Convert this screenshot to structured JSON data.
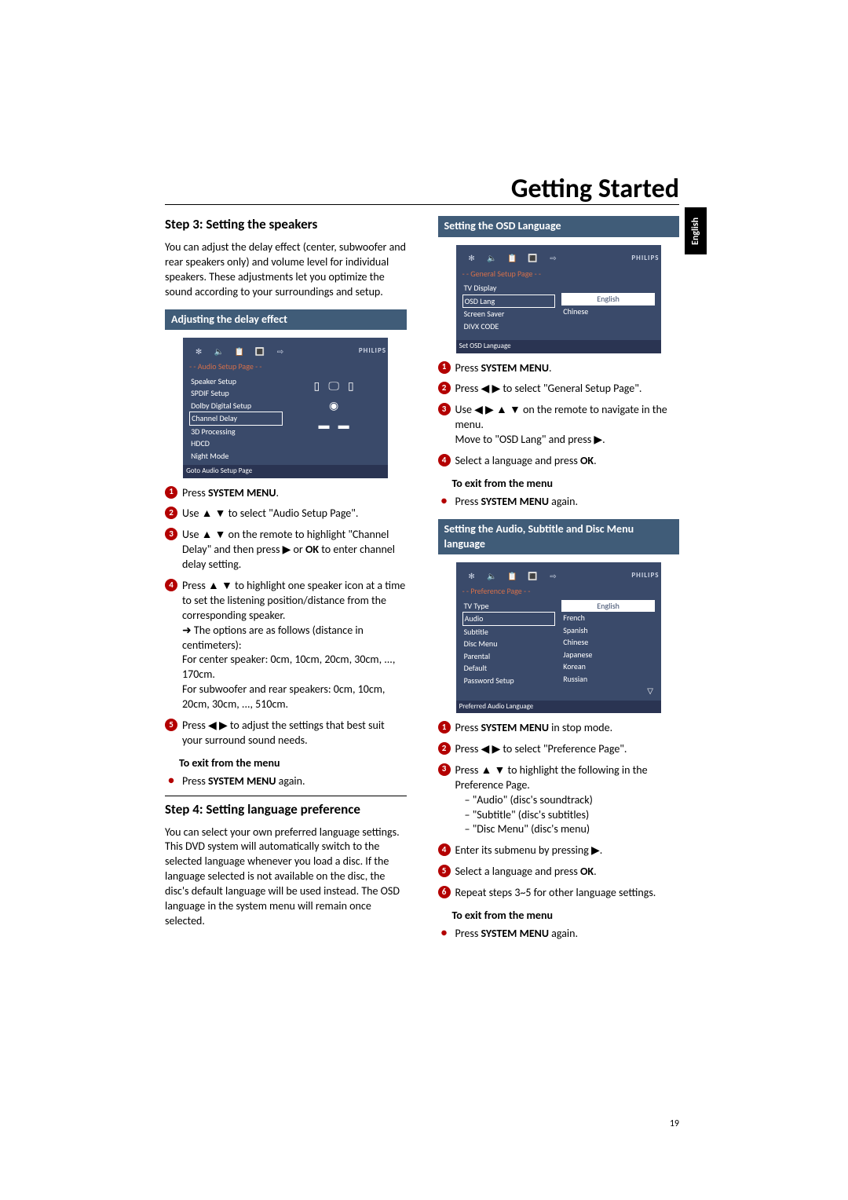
{
  "page_title": "Getting Started",
  "side_tab": "English",
  "page_number": "19",
  "left": {
    "step3_head": "Step 3:  Setting the speakers",
    "step3_intro": "You can adjust the delay effect (center, subwoofer and rear speakers only) and volume level for individual speakers. These adjustments let you optimize the sound according to your surroundings and setup.",
    "adjust_bar": "Adjusting the delay effect",
    "osd_audio": {
      "subtitle": "- -  Audio  Setup  Page  - -",
      "items": [
        "Speaker Setup",
        "SPDIF Setup",
        "Dolby Digital Setup",
        "Channel Delay",
        "3D Processing",
        "HDCD",
        "Night Mode"
      ],
      "footer": "Goto Audio Setup Page"
    },
    "i1": {
      "pre": "Press ",
      "b": "SYSTEM MENU",
      "post": "."
    },
    "i2": "Use ▲ ▼ to select \"Audio Setup Page\".",
    "i3": {
      "part1": "Use ▲ ▼ on the remote to highlight \"Channel Delay\" and then press ▶ or ",
      "b": "OK",
      "part2": " to enter channel delay setting."
    },
    "i4": {
      "l1": "Press ▲ ▼ to highlight one speaker icon at a time to set the listening position/distance from the corresponding speaker.",
      "l2": "➜ The options are as follows (distance in centimeters):",
      "l3": "For center speaker: 0cm, 10cm, 20cm, 30cm, ..., 170cm.",
      "l4": "For subwoofer and rear speakers: 0cm, 10cm, 20cm, 30cm, ..., 510cm."
    },
    "i5": "Press ◀ ▶ to adjust the settings that best suit your surround sound needs.",
    "exit_head": "To exit from the menu",
    "exit": {
      "pre": "Press ",
      "b": "SYSTEM MENU",
      "post": " again."
    },
    "step4_head": "Step 4:  Setting language preference",
    "step4_intro": "You can select your own preferred language settings. This DVD system will automatically switch to the selected language whenever you load a disc. If the language selected is not available on the disc, the disc's default language will be used instead. The OSD language in the system menu will remain once selected."
  },
  "right": {
    "osd_bar": "Setting the OSD Language",
    "osd_general": {
      "subtitle": "- -  General  Setup  Page  - -",
      "left_items": [
        "TV Display",
        "OSD Lang",
        "Screen Saver",
        "DIVX CODE"
      ],
      "right_items": [
        "English",
        "Chinese"
      ],
      "footer": "Set OSD Language"
    },
    "r1": {
      "pre": "Press ",
      "b": "SYSTEM MENU",
      "post": "."
    },
    "r2": "Press ◀ ▶ to select \"General Setup Page\".",
    "r3": {
      "l1": "Use ◀ ▶ ▲ ▼   on the remote to navigate in the menu.",
      "l2": "Move to \"OSD Lang\" and press ▶."
    },
    "r4": {
      "pre": "Select a language and press ",
      "b": "OK",
      "post": "."
    },
    "exit_head": "To exit from the menu",
    "exit": {
      "pre": "Press ",
      "b": "SYSTEM MENU",
      "post": " again."
    },
    "audio_bar": "Setting the Audio, Subtitle and Disc Menu language",
    "osd_pref": {
      "subtitle": "- -  Preference  Page  - -",
      "left_items": [
        "TV Type",
        "Audio",
        "Subtitle",
        "Disc Menu",
        "Parental",
        "Default",
        "Password Setup"
      ],
      "right_items": [
        "English",
        "French",
        "Spanish",
        "Chinese",
        "Japanese",
        "Korean",
        "Russian"
      ],
      "footer": "Preferred Audio Language"
    },
    "p1": {
      "pre": "Press ",
      "b": "SYSTEM MENU",
      "post": " in stop mode."
    },
    "p2": "Press ◀ ▶ to select \"Preference Page\".",
    "p3": {
      "l1": "Press ▲ ▼ to highlight the following in the Preference Page."
    },
    "p3_list": [
      "\"Audio\" (disc's soundtrack)",
      "\"Subtitle\" (disc's subtitles)",
      "\"Disc Menu\" (disc's menu)"
    ],
    "p4": "Enter its submenu by pressing ▶.",
    "p5": {
      "pre": "Select a language and press ",
      "b": "OK",
      "post": "."
    },
    "p6": "Repeat steps 3~5 for other language settings.",
    "exit2_head": "To exit from the menu",
    "exit2": {
      "pre": "Press ",
      "b": "SYSTEM MENU",
      "post": " again."
    }
  },
  "brand": "PHILIPS",
  "osd_icons": [
    "✻",
    "🔈",
    "📋",
    "🔳",
    "⇨"
  ]
}
